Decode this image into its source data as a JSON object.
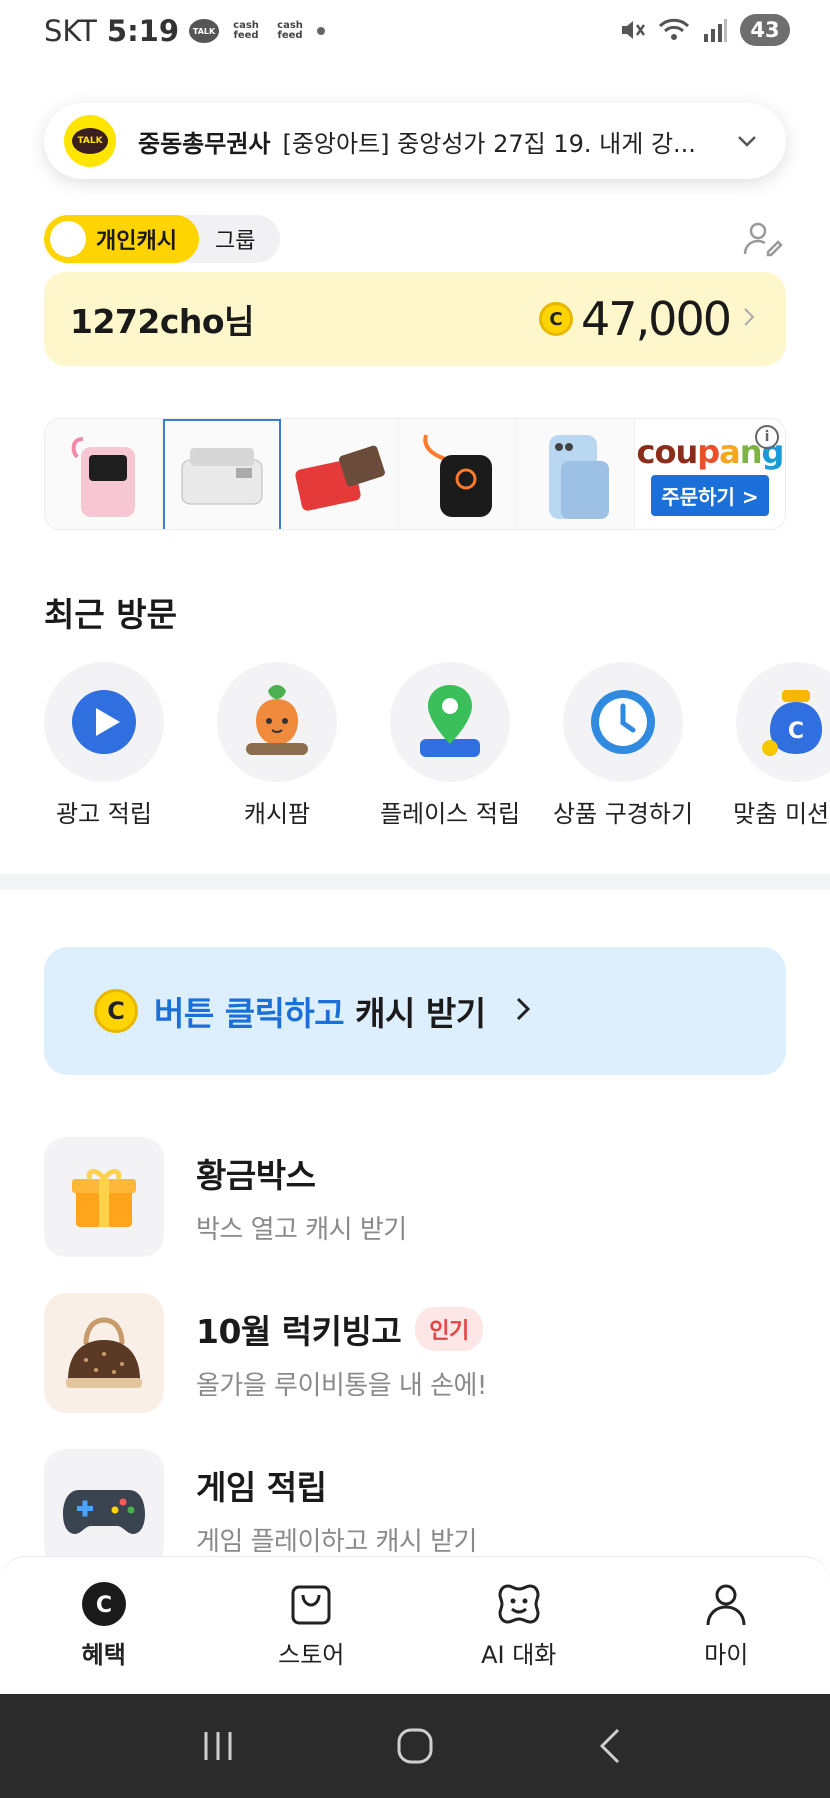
{
  "status_bar": {
    "carrier": "SKT",
    "time": "5:19",
    "apps": [
      "TALK",
      "cash feed",
      "cash feed"
    ],
    "battery": "43"
  },
  "notification": {
    "app_icon": "TALK",
    "sender": "중동총무권사",
    "text": "[중앙아트] 중앙성가 27집 19. 내게 강..."
  },
  "cash_toggle": {
    "active_label": "개인캐시",
    "inactive_label": "그룹"
  },
  "balance": {
    "user": "1272cho님",
    "coin_symbol": "C",
    "amount": "47,000"
  },
  "ads": {
    "items": [
      "pink-power-bank",
      "white-printer",
      "red-leather-wallet",
      "black-tracker",
      "blue-magsafe-battery"
    ],
    "brand": "coupang",
    "button_label": "주문하기 >",
    "info_icon": "i"
  },
  "recent": {
    "title": "최근 방문",
    "items": [
      {
        "label": "광고 적립",
        "icon": "play-icon"
      },
      {
        "label": "캐시팜",
        "icon": "carrot-icon"
      },
      {
        "label": "플레이스 적립",
        "icon": "map-pin-icon"
      },
      {
        "label": "상품 구경하기",
        "icon": "clock-icon"
      },
      {
        "label": "맞춤 미션 적",
        "icon": "money-bag-icon"
      }
    ]
  },
  "promo": {
    "coin_symbol": "C",
    "blue_text": "버튼 클릭하고",
    "dark_text": "캐시 받기"
  },
  "features": [
    {
      "title": "황금박스",
      "subtitle": "박스 열고 캐시 받기",
      "badge": "",
      "icon": "gift-box-icon"
    },
    {
      "title": "10월 럭키빙고",
      "subtitle": "올가을 루이비통을 내 손에!",
      "badge": "인기",
      "icon": "handbag-icon"
    },
    {
      "title": "게임 적립",
      "subtitle": "게임 플레이하고 캐시 받기",
      "badge": "",
      "icon": "gamepad-icon"
    }
  ],
  "bottom_nav": {
    "items": [
      {
        "label": "혜택",
        "icon": "cash-c-icon",
        "active": true
      },
      {
        "label": "스토어",
        "icon": "shopping-bag-icon",
        "active": false
      },
      {
        "label": "AI 대화",
        "icon": "ai-face-icon",
        "active": false
      },
      {
        "label": "마이",
        "icon": "person-icon",
        "active": false
      }
    ]
  },
  "colors": {
    "accent_yellow": "#FFD400",
    "balance_bg": "#FFF7CC",
    "promo_bg": "#DDEEFD",
    "promo_blue": "#1a6fd8",
    "badge_red": "#e64545"
  }
}
